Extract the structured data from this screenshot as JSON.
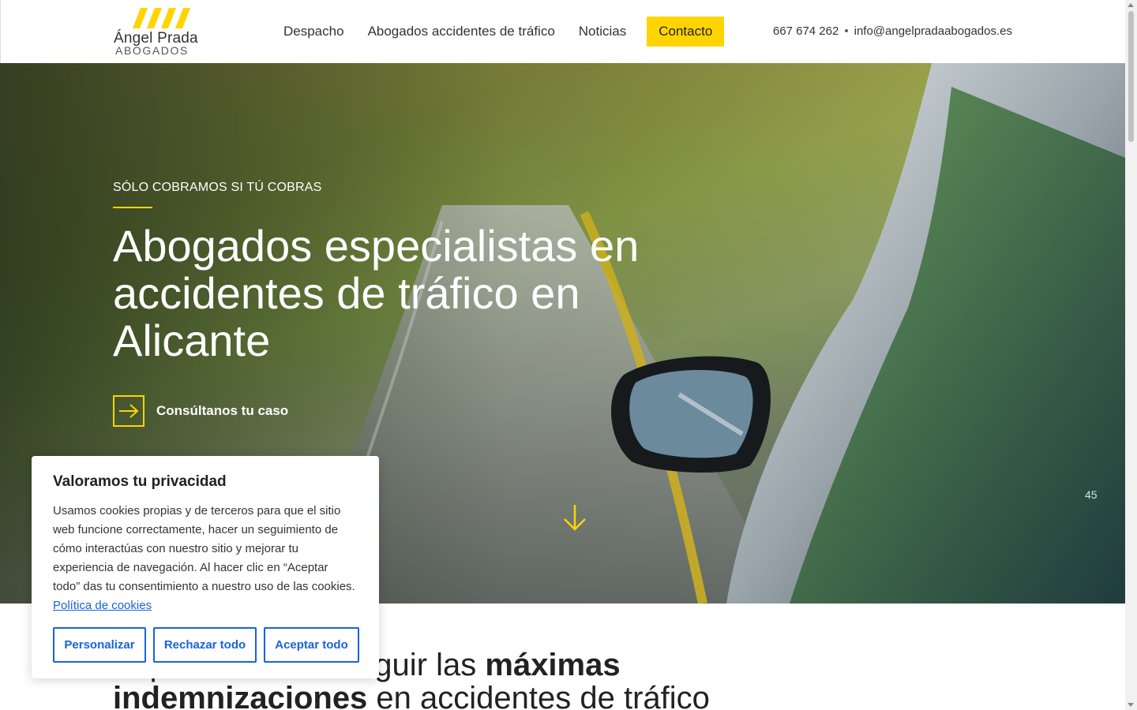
{
  "header": {
    "logo": {
      "name": "Ángel Prada",
      "subtitle": "ABOGADOS"
    },
    "nav": [
      {
        "label": "Despacho"
      },
      {
        "label": "Abogados accidentes de tráfico"
      },
      {
        "label": "Noticias"
      },
      {
        "label": "Contacto"
      }
    ],
    "phone": "667 674 262",
    "separator": "•",
    "email": "info@angelpradaabogados.es"
  },
  "hero": {
    "kicker": "SÓLO COBRAMOS SI TÚ COBRAS",
    "title": "Abogados especialistas en accidentes de tráfico en Alicante",
    "cta_label": "Consúltanos tu caso",
    "mirror_speed": "45"
  },
  "section": {
    "title_part1": "Expertos en conseguir las ",
    "title_bold1": "máximas",
    "title_bold2": "indemnizaciones",
    "title_part2": " en accidentes de tráfico"
  },
  "cookie_banner": {
    "title": "Valoramos tu privacidad",
    "body": "Usamos cookies propias y de terceros para que el sitio web funcione correctamente, hacer un seguimiento de cómo interactúas con nuestro sitio y mejorar tu experiencia de navegación. Al hacer clic en “Aceptar todo” das tu consentimiento a nuestro uso de las cookies.",
    "policy_link": "Política de cookies",
    "buttons": {
      "customize": "Personalizar",
      "reject": "Rechazar todo",
      "accept": "Aceptar todo"
    }
  },
  "colors": {
    "accent": "#ffd400",
    "cookie_blue": "#1863dc"
  }
}
